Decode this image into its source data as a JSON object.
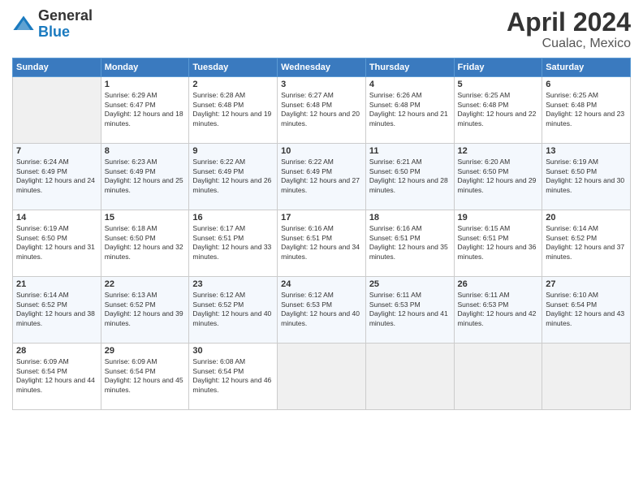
{
  "logo": {
    "line1": "General",
    "line2": "Blue"
  },
  "title": "April 2024",
  "subtitle": "Cualac, Mexico",
  "weekdays": [
    "Sunday",
    "Monday",
    "Tuesday",
    "Wednesday",
    "Thursday",
    "Friday",
    "Saturday"
  ],
  "weeks": [
    [
      {
        "day": null
      },
      {
        "day": "1",
        "sunrise": "Sunrise: 6:29 AM",
        "sunset": "Sunset: 6:47 PM",
        "daylight": "Daylight: 12 hours and 18 minutes."
      },
      {
        "day": "2",
        "sunrise": "Sunrise: 6:28 AM",
        "sunset": "Sunset: 6:48 PM",
        "daylight": "Daylight: 12 hours and 19 minutes."
      },
      {
        "day": "3",
        "sunrise": "Sunrise: 6:27 AM",
        "sunset": "Sunset: 6:48 PM",
        "daylight": "Daylight: 12 hours and 20 minutes."
      },
      {
        "day": "4",
        "sunrise": "Sunrise: 6:26 AM",
        "sunset": "Sunset: 6:48 PM",
        "daylight": "Daylight: 12 hours and 21 minutes."
      },
      {
        "day": "5",
        "sunrise": "Sunrise: 6:25 AM",
        "sunset": "Sunset: 6:48 PM",
        "daylight": "Daylight: 12 hours and 22 minutes."
      },
      {
        "day": "6",
        "sunrise": "Sunrise: 6:25 AM",
        "sunset": "Sunset: 6:48 PM",
        "daylight": "Daylight: 12 hours and 23 minutes."
      }
    ],
    [
      {
        "day": "7",
        "sunrise": "Sunrise: 6:24 AM",
        "sunset": "Sunset: 6:49 PM",
        "daylight": "Daylight: 12 hours and 24 minutes."
      },
      {
        "day": "8",
        "sunrise": "Sunrise: 6:23 AM",
        "sunset": "Sunset: 6:49 PM",
        "daylight": "Daylight: 12 hours and 25 minutes."
      },
      {
        "day": "9",
        "sunrise": "Sunrise: 6:22 AM",
        "sunset": "Sunset: 6:49 PM",
        "daylight": "Daylight: 12 hours and 26 minutes."
      },
      {
        "day": "10",
        "sunrise": "Sunrise: 6:22 AM",
        "sunset": "Sunset: 6:49 PM",
        "daylight": "Daylight: 12 hours and 27 minutes."
      },
      {
        "day": "11",
        "sunrise": "Sunrise: 6:21 AM",
        "sunset": "Sunset: 6:50 PM",
        "daylight": "Daylight: 12 hours and 28 minutes."
      },
      {
        "day": "12",
        "sunrise": "Sunrise: 6:20 AM",
        "sunset": "Sunset: 6:50 PM",
        "daylight": "Daylight: 12 hours and 29 minutes."
      },
      {
        "day": "13",
        "sunrise": "Sunrise: 6:19 AM",
        "sunset": "Sunset: 6:50 PM",
        "daylight": "Daylight: 12 hours and 30 minutes."
      }
    ],
    [
      {
        "day": "14",
        "sunrise": "Sunrise: 6:19 AM",
        "sunset": "Sunset: 6:50 PM",
        "daylight": "Daylight: 12 hours and 31 minutes."
      },
      {
        "day": "15",
        "sunrise": "Sunrise: 6:18 AM",
        "sunset": "Sunset: 6:50 PM",
        "daylight": "Daylight: 12 hours and 32 minutes."
      },
      {
        "day": "16",
        "sunrise": "Sunrise: 6:17 AM",
        "sunset": "Sunset: 6:51 PM",
        "daylight": "Daylight: 12 hours and 33 minutes."
      },
      {
        "day": "17",
        "sunrise": "Sunrise: 6:16 AM",
        "sunset": "Sunset: 6:51 PM",
        "daylight": "Daylight: 12 hours and 34 minutes."
      },
      {
        "day": "18",
        "sunrise": "Sunrise: 6:16 AM",
        "sunset": "Sunset: 6:51 PM",
        "daylight": "Daylight: 12 hours and 35 minutes."
      },
      {
        "day": "19",
        "sunrise": "Sunrise: 6:15 AM",
        "sunset": "Sunset: 6:51 PM",
        "daylight": "Daylight: 12 hours and 36 minutes."
      },
      {
        "day": "20",
        "sunrise": "Sunrise: 6:14 AM",
        "sunset": "Sunset: 6:52 PM",
        "daylight": "Daylight: 12 hours and 37 minutes."
      }
    ],
    [
      {
        "day": "21",
        "sunrise": "Sunrise: 6:14 AM",
        "sunset": "Sunset: 6:52 PM",
        "daylight": "Daylight: 12 hours and 38 minutes."
      },
      {
        "day": "22",
        "sunrise": "Sunrise: 6:13 AM",
        "sunset": "Sunset: 6:52 PM",
        "daylight": "Daylight: 12 hours and 39 minutes."
      },
      {
        "day": "23",
        "sunrise": "Sunrise: 6:12 AM",
        "sunset": "Sunset: 6:52 PM",
        "daylight": "Daylight: 12 hours and 40 minutes."
      },
      {
        "day": "24",
        "sunrise": "Sunrise: 6:12 AM",
        "sunset": "Sunset: 6:53 PM",
        "daylight": "Daylight: 12 hours and 40 minutes."
      },
      {
        "day": "25",
        "sunrise": "Sunrise: 6:11 AM",
        "sunset": "Sunset: 6:53 PM",
        "daylight": "Daylight: 12 hours and 41 minutes."
      },
      {
        "day": "26",
        "sunrise": "Sunrise: 6:11 AM",
        "sunset": "Sunset: 6:53 PM",
        "daylight": "Daylight: 12 hours and 42 minutes."
      },
      {
        "day": "27",
        "sunrise": "Sunrise: 6:10 AM",
        "sunset": "Sunset: 6:54 PM",
        "daylight": "Daylight: 12 hours and 43 minutes."
      }
    ],
    [
      {
        "day": "28",
        "sunrise": "Sunrise: 6:09 AM",
        "sunset": "Sunset: 6:54 PM",
        "daylight": "Daylight: 12 hours and 44 minutes."
      },
      {
        "day": "29",
        "sunrise": "Sunrise: 6:09 AM",
        "sunset": "Sunset: 6:54 PM",
        "daylight": "Daylight: 12 hours and 45 minutes."
      },
      {
        "day": "30",
        "sunrise": "Sunrise: 6:08 AM",
        "sunset": "Sunset: 6:54 PM",
        "daylight": "Daylight: 12 hours and 46 minutes."
      },
      {
        "day": null
      },
      {
        "day": null
      },
      {
        "day": null
      },
      {
        "day": null
      }
    ]
  ]
}
